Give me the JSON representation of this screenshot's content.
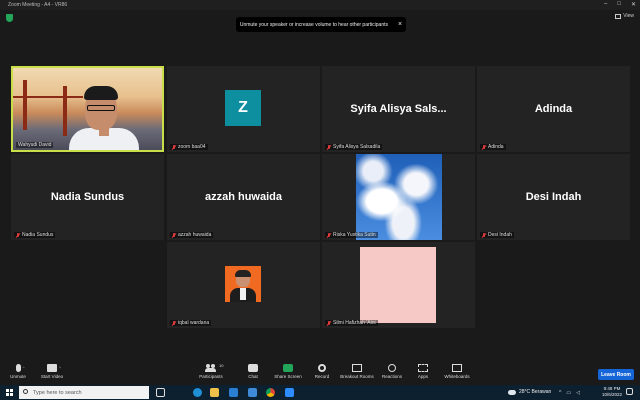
{
  "window": {
    "title": "Zoom Meeting - A4 - VR86"
  },
  "top_right": {
    "view_label": "View"
  },
  "notification": {
    "text": "Unmute your speaker or increase volume to hear other participants",
    "close": "×"
  },
  "participants": [
    {
      "id": "p1",
      "display_name": "Wahyudi David",
      "type": "video",
      "active_speaker": true
    },
    {
      "id": "p2",
      "display_name": "zoom baa04",
      "type": "avatar",
      "avatar_letter": "Z",
      "avatar_color": "#0e8fa0"
    },
    {
      "id": "p3",
      "display_name": "Syifa Alisya Salsadila",
      "type": "name",
      "big_name": "Syifa Alisya Sals..."
    },
    {
      "id": "p4",
      "display_name": "Adinda",
      "type": "name",
      "big_name": "Adinda"
    },
    {
      "id": "p5",
      "display_name": "Nadia Sundus",
      "type": "name",
      "big_name": "Nadia Sundus"
    },
    {
      "id": "p6",
      "display_name": "azzah huwaida",
      "type": "name",
      "big_name": "azzah huwaida"
    },
    {
      "id": "p7",
      "display_name": "Riska Yustika Sutin",
      "type": "image",
      "image": "sky-clouds"
    },
    {
      "id": "p8",
      "display_name": "Desi Indah",
      "type": "name",
      "big_name": "Desi Indah"
    },
    {
      "id": "p9",
      "display_name": "iqbal wardana",
      "type": "photo"
    },
    {
      "id": "p10",
      "display_name": "Silmi Hafizhah 'Aini",
      "type": "pink"
    }
  ],
  "toolbar": {
    "unmute": "Unmute",
    "start_video": "Start Video",
    "participants": "Participants",
    "participants_count": "10",
    "chat": "Chat",
    "share_screen": "Share Screen",
    "record": "Record",
    "breakout_rooms": "Breakout Rooms",
    "reactions": "Reactions",
    "apps": "Apps",
    "whiteboards": "Whiteboards",
    "leave": "Leave Room"
  },
  "taskbar": {
    "search_placeholder": "Type here to search",
    "weather": "28°C  Berawan",
    "time": "9:48 PM",
    "date": "10/6/2022"
  },
  "colors": {
    "active_border": "#c8df4a",
    "leave_button": "#1565d8",
    "share_green": "#23a55a"
  }
}
